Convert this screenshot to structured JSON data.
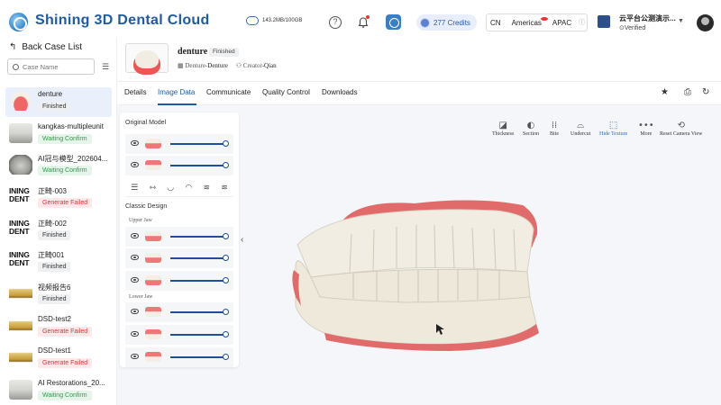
{
  "header": {
    "brand": "Shining 3D Dental Cloud",
    "storage": "143.2MB/100GB",
    "credits": "277 Credits",
    "region": {
      "lang": "CN",
      "americas": "Americas",
      "apac": "APAC"
    },
    "org": {
      "name": "云平台公测演示...",
      "verified": "⊙Verified"
    }
  },
  "sidebar": {
    "back_label": "Back Case List",
    "search_placeholder": "Case Name",
    "cases": [
      {
        "name": "denture",
        "status": "Finished"
      },
      {
        "name": "kangkas-multipleunit",
        "status": "Waiting Confirm"
      },
      {
        "name": "AI冠与模型_202604...",
        "status": "Waiting Confirm"
      },
      {
        "name": "正畸-003",
        "status": "Generate Failed"
      },
      {
        "name": "正畸-002",
        "status": "Finished"
      },
      {
        "name": "正畸001",
        "status": "Finished"
      },
      {
        "name": "视频报告6",
        "status": "Finished"
      },
      {
        "name": "DSD-test2",
        "status": "Generate Failed"
      },
      {
        "name": "DSD-test1",
        "status": "Generate Failed"
      },
      {
        "name": "AI Restorations_20...",
        "status": "Waiting Confirm"
      }
    ],
    "logo_text": "INING\nDENT"
  },
  "case": {
    "title": "denture",
    "status": "Finished",
    "type_prefix": "Denture-",
    "type": "Denture",
    "creator_prefix": "Creator-",
    "creator": "Qian"
  },
  "tabs": [
    "Details",
    "Image Data",
    "Communicate",
    "Quality Control",
    "Downloads"
  ],
  "panel": {
    "original_model": "Original Model",
    "classic_design": "Classic Design",
    "upper_jaw": "Upper Jaw",
    "lower_jaw": "Lower Jaw",
    "slider_value_percent": 100
  },
  "toolbar": [
    {
      "label": "Thickness",
      "icon": "thickness-icon"
    },
    {
      "label": "Section",
      "icon": "section-icon"
    },
    {
      "label": "Bite",
      "icon": "bite-icon"
    },
    {
      "label": "Undercut",
      "icon": "undercut-icon"
    },
    {
      "label": "Hide Texture",
      "icon": "hide-texture-icon"
    },
    {
      "label": "More",
      "icon": "more-icon"
    },
    {
      "label": "Reset Camera View",
      "icon": "reset-camera-icon"
    }
  ],
  "colors": {
    "brand": "#1f5aa6",
    "accent": "#2e6bc6",
    "gum": "#e16a6a",
    "tooth": "#f2ede2"
  }
}
